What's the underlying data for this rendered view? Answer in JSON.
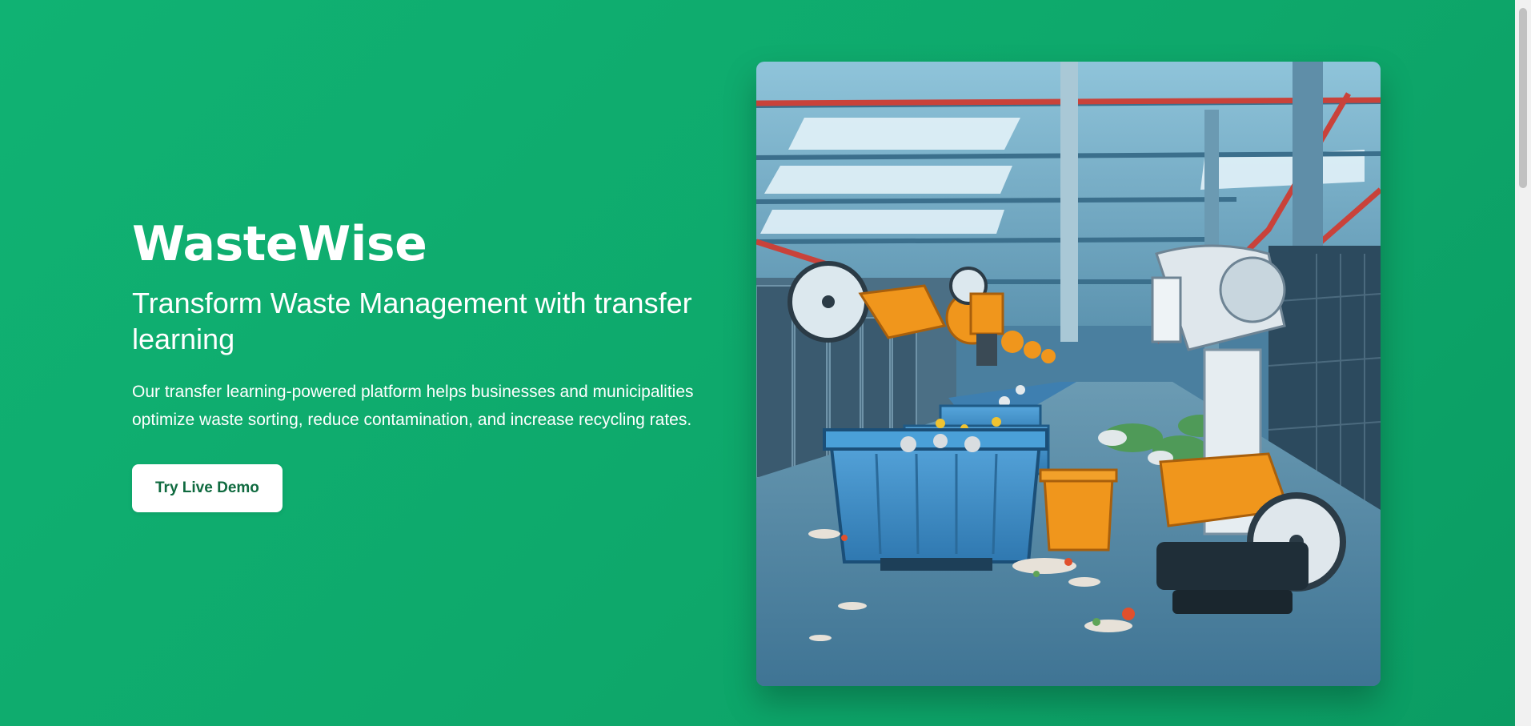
{
  "hero": {
    "brand": "WasteWise",
    "headline": "Transform Waste Management with transfer learning",
    "description": "Our transfer learning-powered platform helps businesses and municipalities optimize waste sorting, reduce contamination, and increase recycling rates.",
    "cta_label": "Try Live Demo"
  },
  "image": {
    "alt": "Robotic arms sorting waste in a recycling facility"
  },
  "colors": {
    "background": "#0fac6d",
    "cta_text": "#0f6a3f",
    "robot_orange": "#f0961c",
    "bin_blue": "#3e8fc9"
  },
  "icons": {
    "scrollbar": "vertical-scrollbar"
  }
}
